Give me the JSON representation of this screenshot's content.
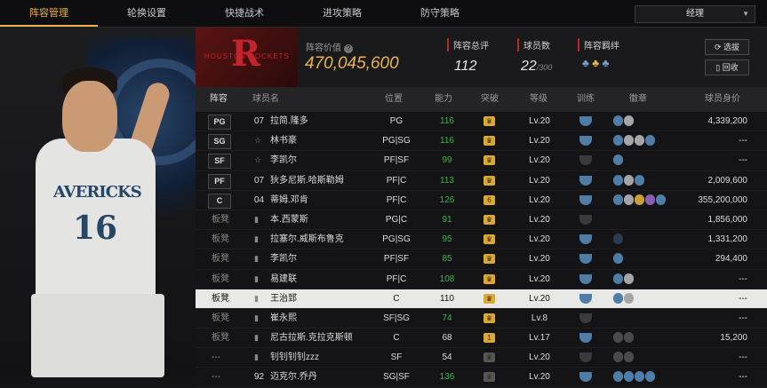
{
  "tabs": [
    "阵容管理",
    "轮换设置",
    "快捷战术",
    "进攻策略",
    "防守策略"
  ],
  "active_tab": 0,
  "dropdown": {
    "value": "经理"
  },
  "team": {
    "logo_text": "HOUSTON ROCKETS"
  },
  "header": {
    "value_label": "阵容价值",
    "value": "470,045,600",
    "rating_label": "阵容总评",
    "rating": "112",
    "players_label": "球员数",
    "players": "22",
    "players_max": "/300",
    "bond_label": "阵容羁绊"
  },
  "buttons": {
    "select": "选拔",
    "recycle": "回收"
  },
  "columns": {
    "lineup": "阵容",
    "name": "球员名",
    "position": "位置",
    "ability": "能力",
    "breakthrough": "突破",
    "level": "等级",
    "training": "训练",
    "badges": "徽章",
    "value": "球员身价"
  },
  "rows": [
    {
      "slot": "PG",
      "starter": true,
      "jersey": "07",
      "name": "拉简.隆多",
      "pos": "PG",
      "ability": "116",
      "green": true,
      "break": "",
      "level": "Lv.20",
      "badges": [
        "b",
        "s"
      ],
      "value": "4,339,200"
    },
    {
      "slot": "SG",
      "starter": true,
      "jersey": "",
      "name": "林书豪",
      "pos": "PG|SG",
      "ability": "116",
      "green": true,
      "break": "",
      "level": "Lv.20",
      "badges": [
        "b",
        "s",
        "s",
        "b"
      ],
      "value": "---"
    },
    {
      "slot": "SF",
      "starter": true,
      "jersey": "",
      "name": "李凯尔",
      "pos": "PF|SF",
      "ability": "99",
      "green": true,
      "break": "",
      "level": "Lv.20",
      "badges": [
        "b"
      ],
      "value": "---"
    },
    {
      "slot": "PF",
      "starter": true,
      "jersey": "07",
      "name": "狄多尼斯.哈斯勒姆",
      "pos": "PF|C",
      "ability": "113",
      "green": true,
      "break": "",
      "level": "Lv.20",
      "badges": [
        "b",
        "s",
        "b"
      ],
      "value": "2,009,600"
    },
    {
      "slot": "C",
      "starter": true,
      "jersey": "04",
      "name": "蒂姆.邓肯",
      "pos": "PF|C",
      "ability": "126",
      "green": true,
      "break": "6",
      "level": "Lv.20",
      "badges": [
        "b",
        "s",
        "g",
        "p",
        "b"
      ],
      "value": "355,200,000"
    },
    {
      "slot": "板凳",
      "starter": false,
      "jersey": "",
      "name": "本.西蒙斯",
      "pos": "PG|C",
      "ability": "91",
      "green": true,
      "break": "",
      "level": "Lv.20",
      "badges": [],
      "value": "1,856,000"
    },
    {
      "slot": "板凳",
      "starter": false,
      "jersey": "",
      "name": "拉塞尔.威斯布鲁克",
      "pos": "PG|SG",
      "ability": "95",
      "green": true,
      "break": "",
      "level": "Lv.20",
      "badges": [
        "n"
      ],
      "value": "1,331,200"
    },
    {
      "slot": "板凳",
      "starter": false,
      "jersey": "",
      "name": "李凯尔",
      "pos": "PF|SF",
      "ability": "85",
      "green": true,
      "break": "",
      "level": "Lv.20",
      "badges": [
        "b"
      ],
      "value": "294,400"
    },
    {
      "slot": "板凳",
      "starter": false,
      "jersey": "",
      "name": "易建联",
      "pos": "PF|C",
      "ability": "108",
      "green": true,
      "break": "",
      "level": "Lv.20",
      "badges": [
        "b",
        "s"
      ],
      "value": "---"
    },
    {
      "slot": "板凳",
      "starter": false,
      "jersey": "",
      "name": "王治郅",
      "pos": "C",
      "ability": "110",
      "green": false,
      "break": "",
      "level": "Lv.20",
      "badges": [
        "b",
        "s"
      ],
      "value": "---",
      "selected": true
    },
    {
      "slot": "板凳",
      "starter": false,
      "jersey": "",
      "name": "崔永熙",
      "pos": "SF|SG",
      "ability": "74",
      "green": true,
      "break": "",
      "level": "Lv.8",
      "badges": [],
      "value": "---"
    },
    {
      "slot": "板凳",
      "starter": false,
      "jersey": "",
      "name": "尼古拉斯.克拉克斯顿",
      "pos": "C",
      "ability": "68",
      "green": false,
      "break": "1",
      "level": "Lv.17",
      "badges": [
        "d",
        "d"
      ],
      "value": "15,200"
    },
    {
      "slot": "---",
      "starter": false,
      "jersey": "",
      "name": "钊钊钊钊zzz",
      "pos": "SF",
      "ability": "54",
      "green": false,
      "break": "",
      "level": "Lv.20",
      "badges": [
        "d",
        "d"
      ],
      "value": "---"
    },
    {
      "slot": "---",
      "starter": false,
      "jersey": "92",
      "name": "迈克尔.乔丹",
      "pos": "SG|SF",
      "ability": "136",
      "green": true,
      "break": "",
      "level": "Lv.20",
      "badges": [
        "b",
        "b",
        "b",
        "b"
      ],
      "value": "---"
    }
  ],
  "player_card": {
    "jersey_text": "AVERICKS",
    "number": "16"
  }
}
